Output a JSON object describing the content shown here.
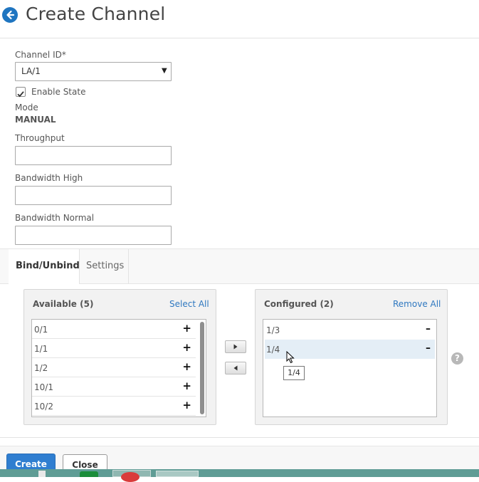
{
  "header": {
    "back_icon": "arrow-left-circle-icon",
    "title": "Create Channel"
  },
  "form": {
    "channel_id": {
      "label": "Channel ID*",
      "value": "LA/1",
      "arrow": "▼"
    },
    "enable_state": {
      "label": "Enable State",
      "checked": true
    },
    "mode": {
      "label": "Mode",
      "value": "MANUAL"
    },
    "throughput": {
      "label": "Throughput",
      "value": ""
    },
    "bandwidth_high": {
      "label": "Bandwidth High",
      "value": ""
    },
    "bandwidth_normal": {
      "label": "Bandwidth Normal",
      "value": ""
    }
  },
  "tabs": [
    {
      "label": "Bind/Unbind",
      "active": true
    },
    {
      "label": "Settings",
      "active": false
    }
  ],
  "available": {
    "title": "Available (5)",
    "action": "Select All",
    "items": [
      "0/1",
      "1/1",
      "1/2",
      "10/1",
      "10/2"
    ],
    "add_symbol": "+"
  },
  "configured": {
    "title": "Configured (2)",
    "action": "Remove All",
    "items": [
      "1/3",
      "1/4"
    ],
    "remove_symbol": "–",
    "highlighted_item": "1/4"
  },
  "tooltip": "1/4",
  "help_symbol": "?",
  "footer": {
    "create_label": "Create",
    "close_label": "Close"
  },
  "colors": {
    "accent": "#2f7ed0",
    "link": "#2f78c0",
    "highlight_row": "#e4eef6"
  }
}
